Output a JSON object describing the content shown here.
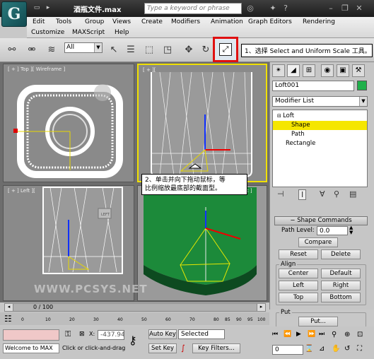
{
  "window": {
    "title": "酒瓶文件.max",
    "logo_text": "G",
    "search_placeholder": "Type a keyword or phrase"
  },
  "menu": {
    "row1": [
      "Edit",
      "Tools",
      "Group",
      "Views",
      "Create",
      "Modifiers",
      "Animation",
      "Graph Editors",
      "Rendering"
    ],
    "row2": [
      "Customize",
      "MAXScript",
      "Help"
    ]
  },
  "toolbar": {
    "selection_filter": "All"
  },
  "callouts": {
    "step1": "1、选择 Select and Uniform Scale 工具。",
    "step2_line1": "2、单击并向下拖动鼠标，等",
    "step2_line2": "比例缩放最底部的截面型。"
  },
  "viewports": {
    "top_label": "[ + ] Top ][ Wireframe ]",
    "front_label": "[ + ][",
    "left_label": "[ + ] Left ][",
    "persp_label": "lit ]",
    "left_box": "LEFT",
    "watermark": "WWW.PCSYS.NET"
  },
  "command_panel": {
    "object_name": "Loft001",
    "object_color": "#1fb04a",
    "modifier_list": "Modifier List",
    "stack": {
      "loft": "Loft",
      "shape": "Shape",
      "path": "Path",
      "rectangle": "Rectangle"
    },
    "rollout_title": "Shape Commands",
    "path_level_label": "Path Level:",
    "path_level_value": "0.0",
    "compare": "Compare",
    "reset": "Reset",
    "delete": "Delete",
    "align_label": "Align",
    "center": "Center",
    "default": "Default",
    "left": "Left",
    "right": "Right",
    "top": "Top",
    "bottom": "Bottom",
    "put_label": "Put",
    "put": "Put..."
  },
  "timeline": {
    "frame_text": "0 / 100",
    "ticks": [
      "0",
      "10",
      "20",
      "30",
      "40",
      "50",
      "60",
      "70",
      "80",
      "85",
      "90",
      "95",
      "100"
    ]
  },
  "status": {
    "welcome": "Welcome to MAX",
    "coord_x": "-437.94",
    "prompt": "Click or click-and-drag",
    "auto_key": "Auto Key",
    "set_key": "Set Key",
    "key_mode": "Selected",
    "key_filters": "Key Filters...",
    "frame": "0"
  },
  "colors": {
    "highlight_border": "#e01010",
    "selected_stack": "#f5e600",
    "persp_green": "#1c8a3a"
  }
}
